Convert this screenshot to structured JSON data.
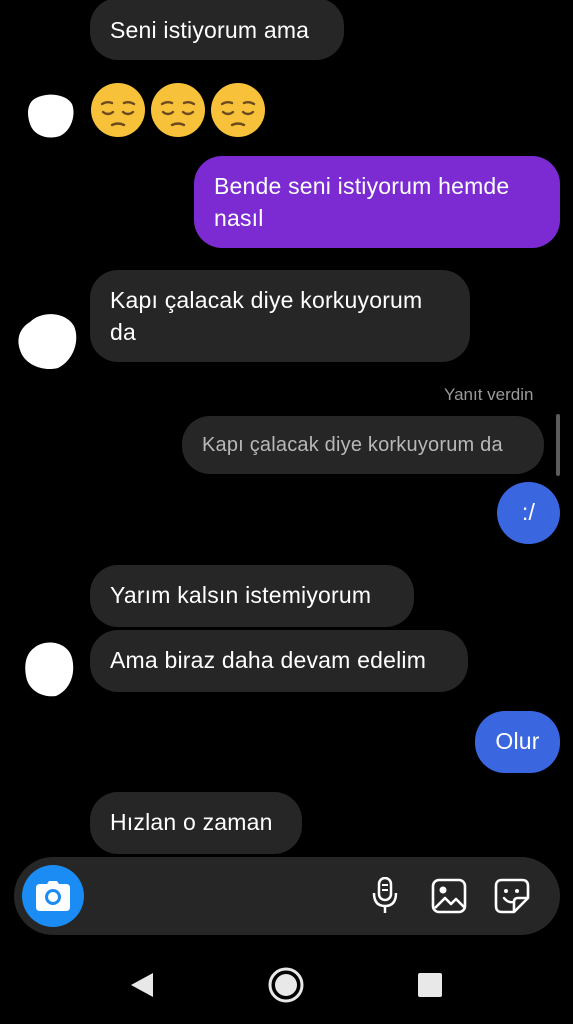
{
  "messages": {
    "m1": "Seni istiyorum ama",
    "m3": "Bende seni istiyorum hemde nasıl",
    "m4": "Kapı çalacak diye korkuyorum da",
    "reply_label": "Yanıt verdin",
    "reply_quote": "Kapı çalacak diye korkuyorum da",
    "m5": ":/",
    "m6": "Yarım kalsın istemiyorum",
    "m7": "Ama biraz daha devam edelim",
    "m8": "Olur",
    "m9": "Hızlan o zaman"
  },
  "emoji_message": [
    "pensive-face",
    "pensive-face",
    "pensive-face"
  ],
  "composer": {
    "camera": "camera-icon",
    "mic": "microphone-icon",
    "gallery": "image-icon",
    "sticker": "sticker-icon"
  },
  "navbar": {
    "back": "back-triangle-icon",
    "home": "home-circle-icon",
    "recents": "recents-square-icon"
  },
  "colors": {
    "incoming": "#262626",
    "outgoing_purple": "#7b2bd1",
    "outgoing_blue": "#3a66e0",
    "camera_button": "#1a8cf3"
  }
}
